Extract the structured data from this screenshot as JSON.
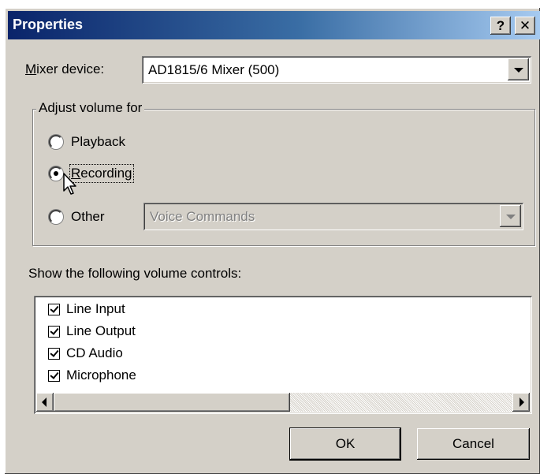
{
  "window": {
    "title": "Properties",
    "help_button_label": "?",
    "close_button_label": "✕"
  },
  "mixer": {
    "accel": "M",
    "label_rest": "ixer device:",
    "selected": "AD1815/6 Mixer (500)"
  },
  "adjust_group": {
    "title": "Adjust volume for",
    "options": [
      {
        "label": "Playback",
        "checked": false
      },
      {
        "accel": "R",
        "label_rest": "ecording",
        "checked": true
      },
      {
        "label": "Other",
        "checked": false
      }
    ],
    "other_combo_value": "Voice Commands"
  },
  "controls": {
    "label": "Show the following volume controls:",
    "items": [
      {
        "label": "Line Input",
        "checked": true
      },
      {
        "label": "Line Output",
        "checked": true
      },
      {
        "label": "CD Audio",
        "checked": true
      },
      {
        "label": "Microphone",
        "checked": true
      }
    ]
  },
  "buttons": {
    "ok": "OK",
    "cancel": "Cancel"
  },
  "icons": {
    "dropdown": "chevron-down-icon",
    "scroll_left": "arrow-left-icon",
    "scroll_right": "arrow-right-icon",
    "cursor": "mouse-pointer-icon"
  },
  "colors": {
    "titlebar_start": "#0a246a",
    "titlebar_end": "#a6caf0",
    "face": "#d4d0c8"
  }
}
